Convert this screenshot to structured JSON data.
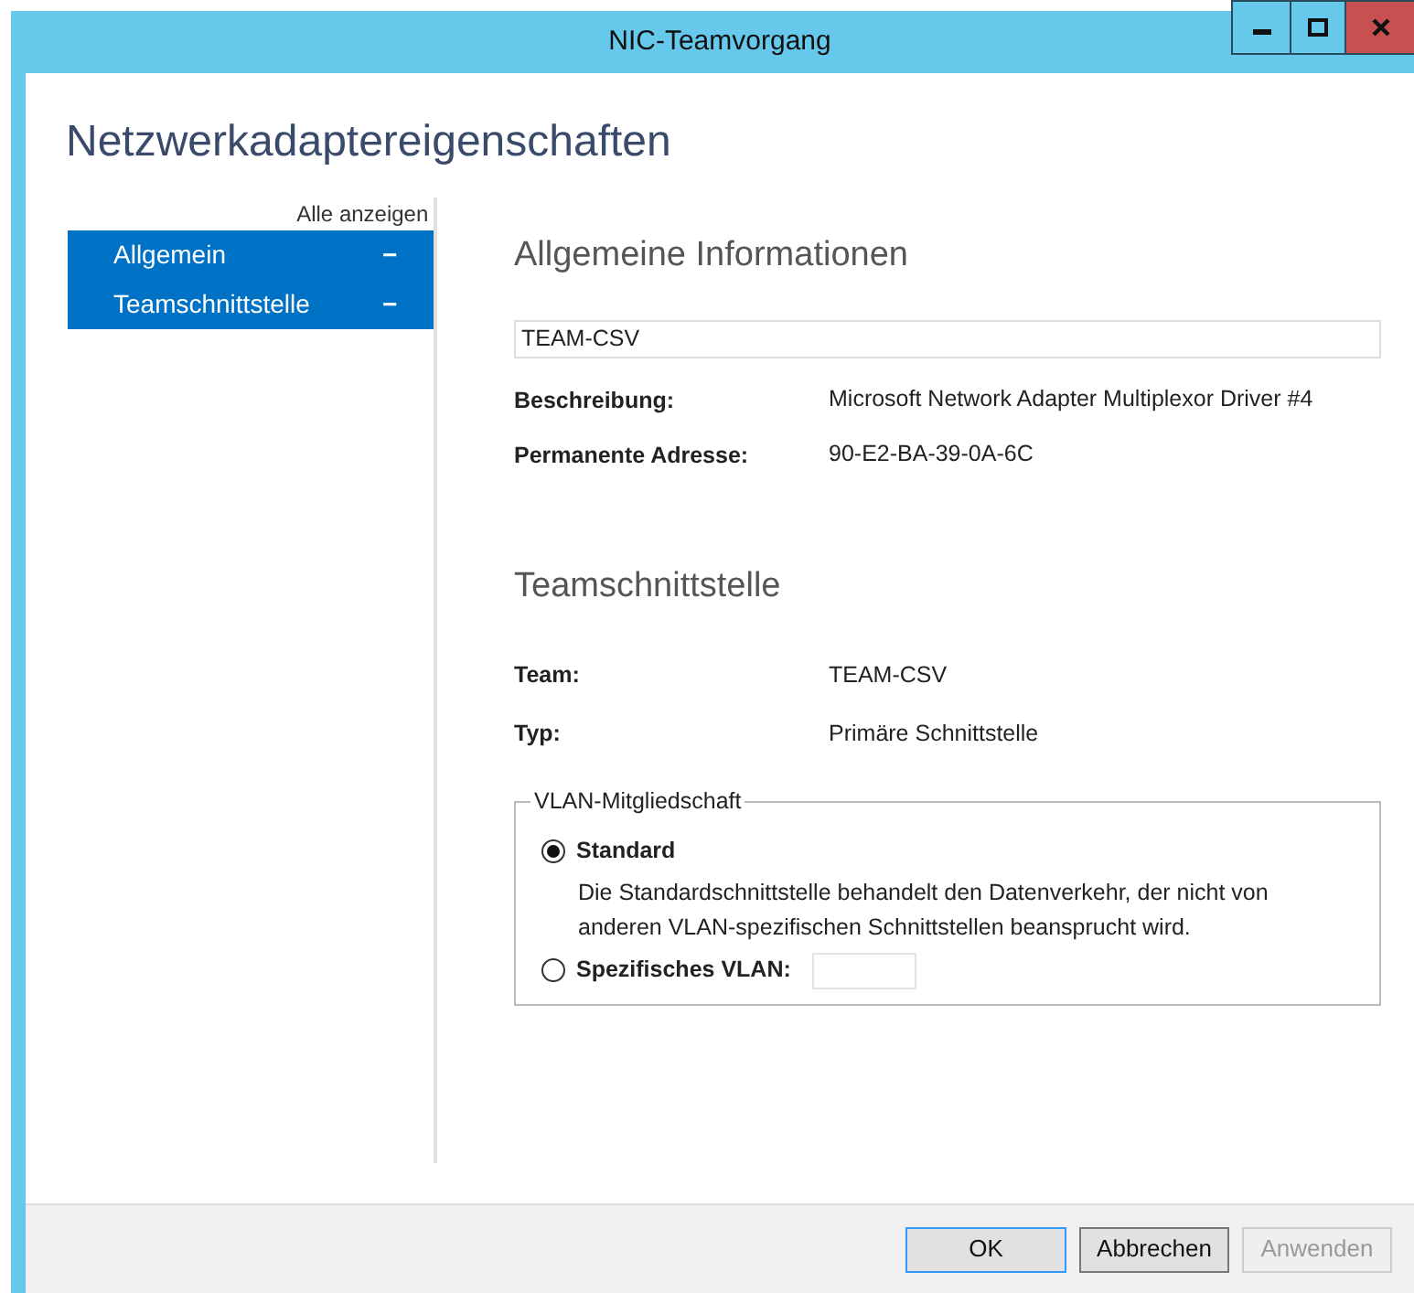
{
  "window": {
    "title": "NIC-Teamvorgang",
    "controls": [
      {
        "kind": "minimize"
      },
      {
        "kind": "maximize"
      },
      {
        "kind": "close"
      }
    ]
  },
  "heading": "Netzwerkadaptereigenschaften",
  "sidebar": {
    "show_all": "Alle anzeigen",
    "items": [
      {
        "label": "Allgemein",
        "symbol": "−",
        "expanded": true
      },
      {
        "label": "Teamschnittstelle",
        "symbol": "−",
        "expanded": true
      }
    ]
  },
  "general": {
    "title": "Allgemeine Informationen",
    "name": "TEAM-CSV",
    "fields": [
      {
        "label": "Beschreibung:",
        "value": "Microsoft Network Adapter Multiplexor Driver #4"
      },
      {
        "label": "Permanente Adresse:",
        "value": "90-E2-BA-39-0A-6C"
      }
    ]
  },
  "team_interface": {
    "title": "Teamschnittstelle",
    "fields": [
      {
        "label": "Team:",
        "value": "TEAM-CSV"
      },
      {
        "label": "Typ:",
        "value": "Primäre Schnittstelle"
      }
    ],
    "vlan": {
      "legend": "VLAN-Mitgliedschaft",
      "options": [
        {
          "kind": "described",
          "label": "Standard",
          "selected": true,
          "description": "Die Standardschnittstelle behandelt den Datenverkehr, der nicht von anderen VLAN-spezifischen Schnittstellen beansprucht wird."
        },
        {
          "kind": "with_input",
          "label": "Spezifisches VLAN:",
          "selected": false
        }
      ]
    }
  },
  "buttons": [
    {
      "label": "OK",
      "kind": "default",
      "disabled": false
    },
    {
      "label": "Abbrechen",
      "kind": "normal",
      "disabled": false
    },
    {
      "label": "Anwenden",
      "kind": "normal",
      "disabled": true
    }
  ]
}
